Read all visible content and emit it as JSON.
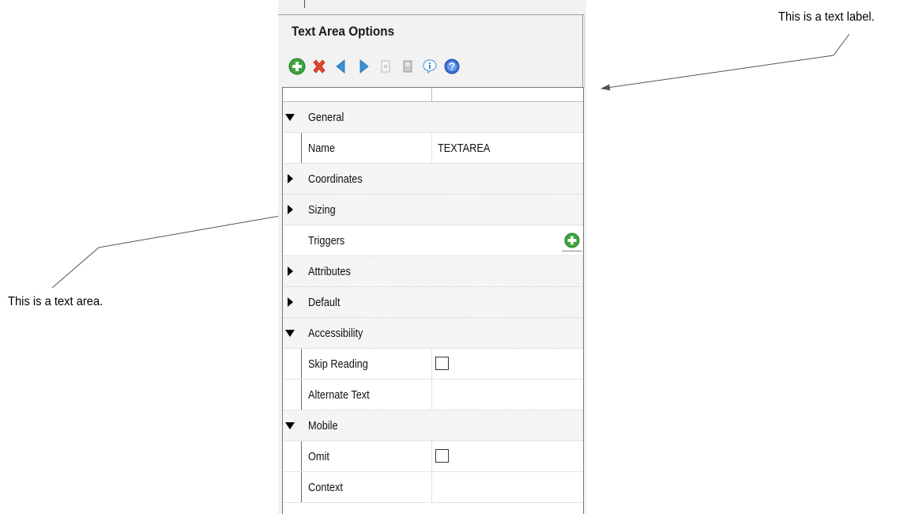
{
  "callouts": {
    "text_label": "This is a text label.",
    "text_area": "This is a text area."
  },
  "panel": {
    "title": "Text Area Options",
    "toolbar": [
      {
        "icon": "add-icon",
        "color": "#3aa53a"
      },
      {
        "icon": "delete-icon",
        "color": "#e5462c"
      },
      {
        "icon": "move-left-icon",
        "color": "#3a8fd6"
      },
      {
        "icon": "move-right-icon",
        "color": "#3a8fd6"
      },
      {
        "icon": "disabled-doc-icon",
        "color": "#b8b8b8"
      },
      {
        "icon": "disabled-page-icon",
        "color": "#b8b8b8"
      },
      {
        "icon": "info-icon",
        "color": "#3a8fd6"
      },
      {
        "icon": "help-icon",
        "color": "#3a6fd6"
      }
    ]
  },
  "grid": {
    "rows": [
      {
        "kind": "category",
        "label": "General",
        "state": "expanded"
      },
      {
        "kind": "property",
        "label": "Name",
        "value": "TEXTAREA"
      },
      {
        "kind": "category",
        "label": "Coordinates",
        "state": "collapsed"
      },
      {
        "kind": "category",
        "label": "Sizing",
        "state": "collapsed"
      },
      {
        "kind": "property-plain",
        "label": "Triggers",
        "value": ""
      },
      {
        "kind": "category",
        "label": "Attributes",
        "state": "collapsed"
      },
      {
        "kind": "category",
        "label": "Default",
        "state": "collapsed"
      },
      {
        "kind": "category",
        "label": "Accessibility",
        "state": "expanded"
      },
      {
        "kind": "property",
        "label": "Skip Reading",
        "value": ""
      },
      {
        "kind": "property",
        "label": "Alternate Text",
        "value": ""
      },
      {
        "kind": "category",
        "label": "Mobile",
        "state": "expanded"
      },
      {
        "kind": "property",
        "label": "Omit",
        "value": ""
      },
      {
        "kind": "property",
        "label": "Context",
        "value": ""
      }
    ]
  }
}
